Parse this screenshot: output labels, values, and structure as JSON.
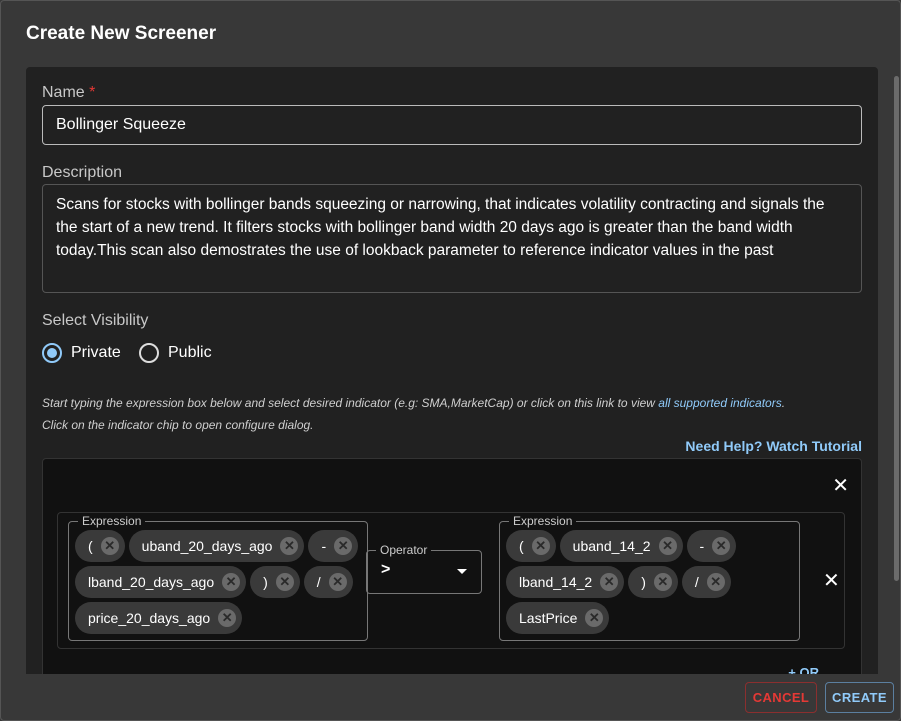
{
  "dialog": {
    "title": "Create New Screener"
  },
  "form": {
    "name_label": "Name",
    "required_mark": "*",
    "name_value": "Bollinger Squeeze",
    "description_label": "Description",
    "description_value": "Scans for stocks with bollinger bands squeezing or narrowing, that indicates volatility contracting and signals the the start of a new trend. It filters stocks with bollinger band width 20 days ago is greater than the band width today.This scan also demostrates the use of lookback parameter to reference indicator values in the past",
    "visibility_label": "Select Visibility",
    "visibility_options": [
      {
        "label": "Private",
        "selected": true
      },
      {
        "label": "Public",
        "selected": false
      }
    ],
    "hint_line1": "Start typing the expression box below and select desired indicator (e.g: SMA,MarketCap) or click on this link to view ",
    "hint_link": "all supported indicators",
    "hint_line1_end": ".",
    "hint_line2": "Click on the indicator chip to open configure dialog.",
    "help_link": "Need Help? Watch Tutorial"
  },
  "condition": {
    "left_label": "Expression",
    "left_chips": [
      "(",
      "uband_20_days_ago",
      "-",
      "lband_20_days_ago",
      ")",
      "/",
      "price_20_days_ago"
    ],
    "operator_label": "Operator",
    "operator_value": ">",
    "right_label": "Expression",
    "right_chips": [
      "(",
      "uband_14_2",
      "-",
      "lband_14_2",
      ")",
      "/",
      "LastPrice"
    ],
    "or_label": "+ OR"
  },
  "footer": {
    "cancel": "CANCEL",
    "create": "CREATE"
  },
  "colors": {
    "accent": "#90caf9",
    "danger": "#e53935",
    "dialog_bg": "#383838",
    "panel_bg": "#212121"
  }
}
